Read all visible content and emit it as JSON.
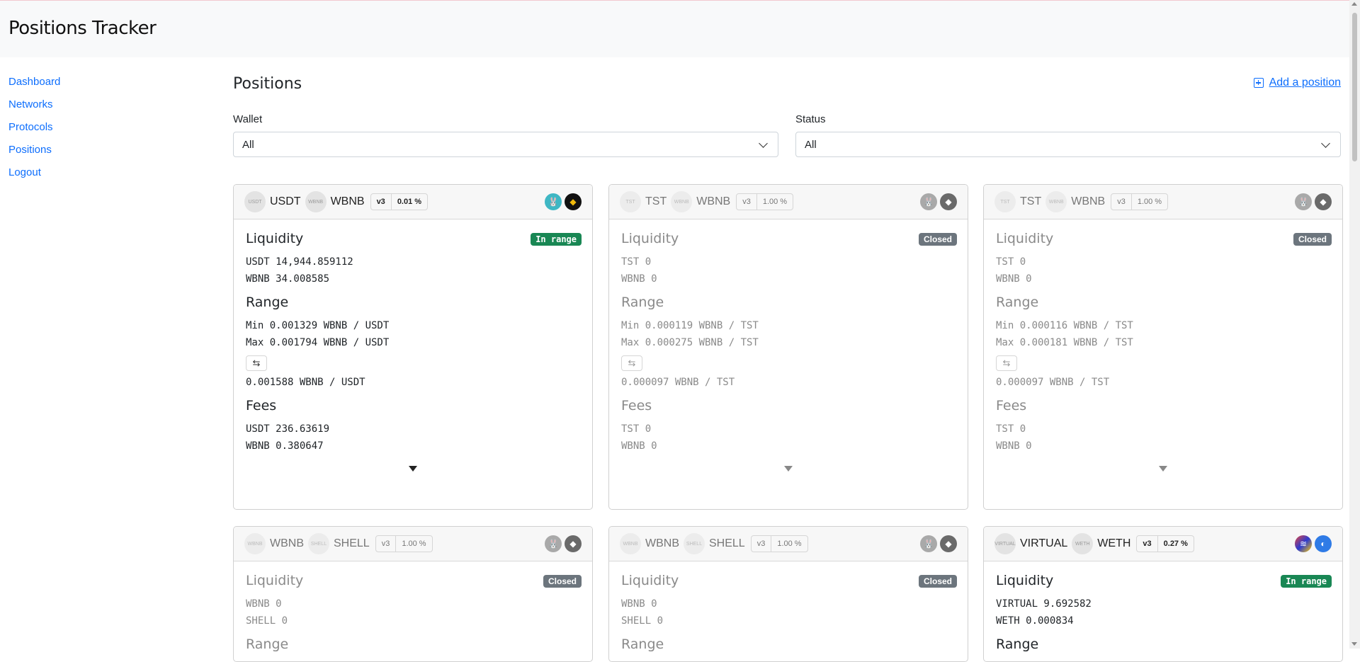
{
  "app": {
    "title": "Positions Tracker"
  },
  "nav": {
    "items": [
      {
        "label": "Dashboard"
      },
      {
        "label": "Networks"
      },
      {
        "label": "Protocols"
      },
      {
        "label": "Positions"
      },
      {
        "label": "Logout"
      }
    ]
  },
  "page": {
    "title": "Positions",
    "add_label": "Add a position",
    "filters": {
      "wallet": {
        "label": "Wallet",
        "value": "All"
      },
      "status": {
        "label": "Status",
        "value": "All"
      }
    }
  },
  "labels": {
    "liquidity": "Liquidity",
    "range": "Range",
    "fees": "Fees"
  },
  "cards": [
    {
      "token0": "USDT",
      "token0_icon": "USDT",
      "token1": "WBNB",
      "token1_icon": "WBNB",
      "version": "v3",
      "fee": "0.01 %",
      "status": "In range",
      "networks": [
        "pancakeswap-icon",
        "bnb-chain-icon"
      ],
      "liquidity": [
        "USDT 14,944.859112",
        "WBNB 34.008585"
      ],
      "range_min": "Min 0.001329 WBNB / USDT",
      "range_max": "Max 0.001794 WBNB / USDT",
      "current": "0.001588 WBNB / USDT",
      "swap": "⇆",
      "fees": [
        "USDT 236.63619",
        "WBNB 0.380647"
      ]
    },
    {
      "token0": "TST",
      "token0_icon": "TST",
      "token1": "WBNB",
      "token1_icon": "WBNB",
      "version": "v3",
      "fee": "1.00 %",
      "status": "Closed",
      "networks": [
        "pancakeswap-icon",
        "bnb-chain-icon"
      ],
      "liquidity": [
        "TST 0",
        "WBNB 0"
      ],
      "range_min": "Min 0.000119 WBNB / TST",
      "range_max": "Max 0.000275 WBNB / TST",
      "current": "0.000097 WBNB / TST",
      "swap": "⇆",
      "fees": [
        "TST 0",
        "WBNB 0"
      ]
    },
    {
      "token0": "TST",
      "token0_icon": "TST",
      "token1": "WBNB",
      "token1_icon": "WBNB",
      "version": "v3",
      "fee": "1.00 %",
      "status": "Closed",
      "networks": [
        "pancakeswap-icon",
        "bnb-chain-icon"
      ],
      "liquidity": [
        "TST 0",
        "WBNB 0"
      ],
      "range_min": "Min 0.000116 WBNB / TST",
      "range_max": "Max 0.000181 WBNB / TST",
      "current": "0.000097 WBNB / TST",
      "swap": "⇆",
      "fees": [
        "TST 0",
        "WBNB 0"
      ]
    },
    {
      "token0": "WBNB",
      "token0_icon": "WBNB",
      "token1": "SHELL",
      "token1_icon": "SHELL",
      "version": "v3",
      "fee": "1.00 %",
      "status": "Closed",
      "networks": [
        "pancakeswap-icon",
        "bnb-chain-icon"
      ],
      "liquidity": [
        "WBNB 0",
        "SHELL 0"
      ],
      "range_heading": "Range"
    },
    {
      "token0": "WBNB",
      "token0_icon": "WBNB",
      "token1": "SHELL",
      "token1_icon": "SHELL",
      "version": "v3",
      "fee": "1.00 %",
      "status": "Closed",
      "networks": [
        "pancakeswap-icon",
        "bnb-chain-icon"
      ],
      "liquidity": [
        "WBNB 0",
        "SHELL 0"
      ],
      "range_heading": "Range"
    },
    {
      "token0": "VIRTUAL",
      "token0_icon": "VIRTUAL",
      "token1": "WETH",
      "token1_icon": "WETH",
      "version": "v3",
      "fee": "0.27 %",
      "status": "In range",
      "networks": [
        "uniswap-icon",
        "base-chain-icon"
      ],
      "liquidity": [
        "VIRTUAL 9.692582",
        "WETH 0.000834"
      ],
      "range_heading": "Range"
    }
  ],
  "colors": {
    "accent": "#0d6efd",
    "in_range": "#198754",
    "closed": "#6c757d"
  }
}
